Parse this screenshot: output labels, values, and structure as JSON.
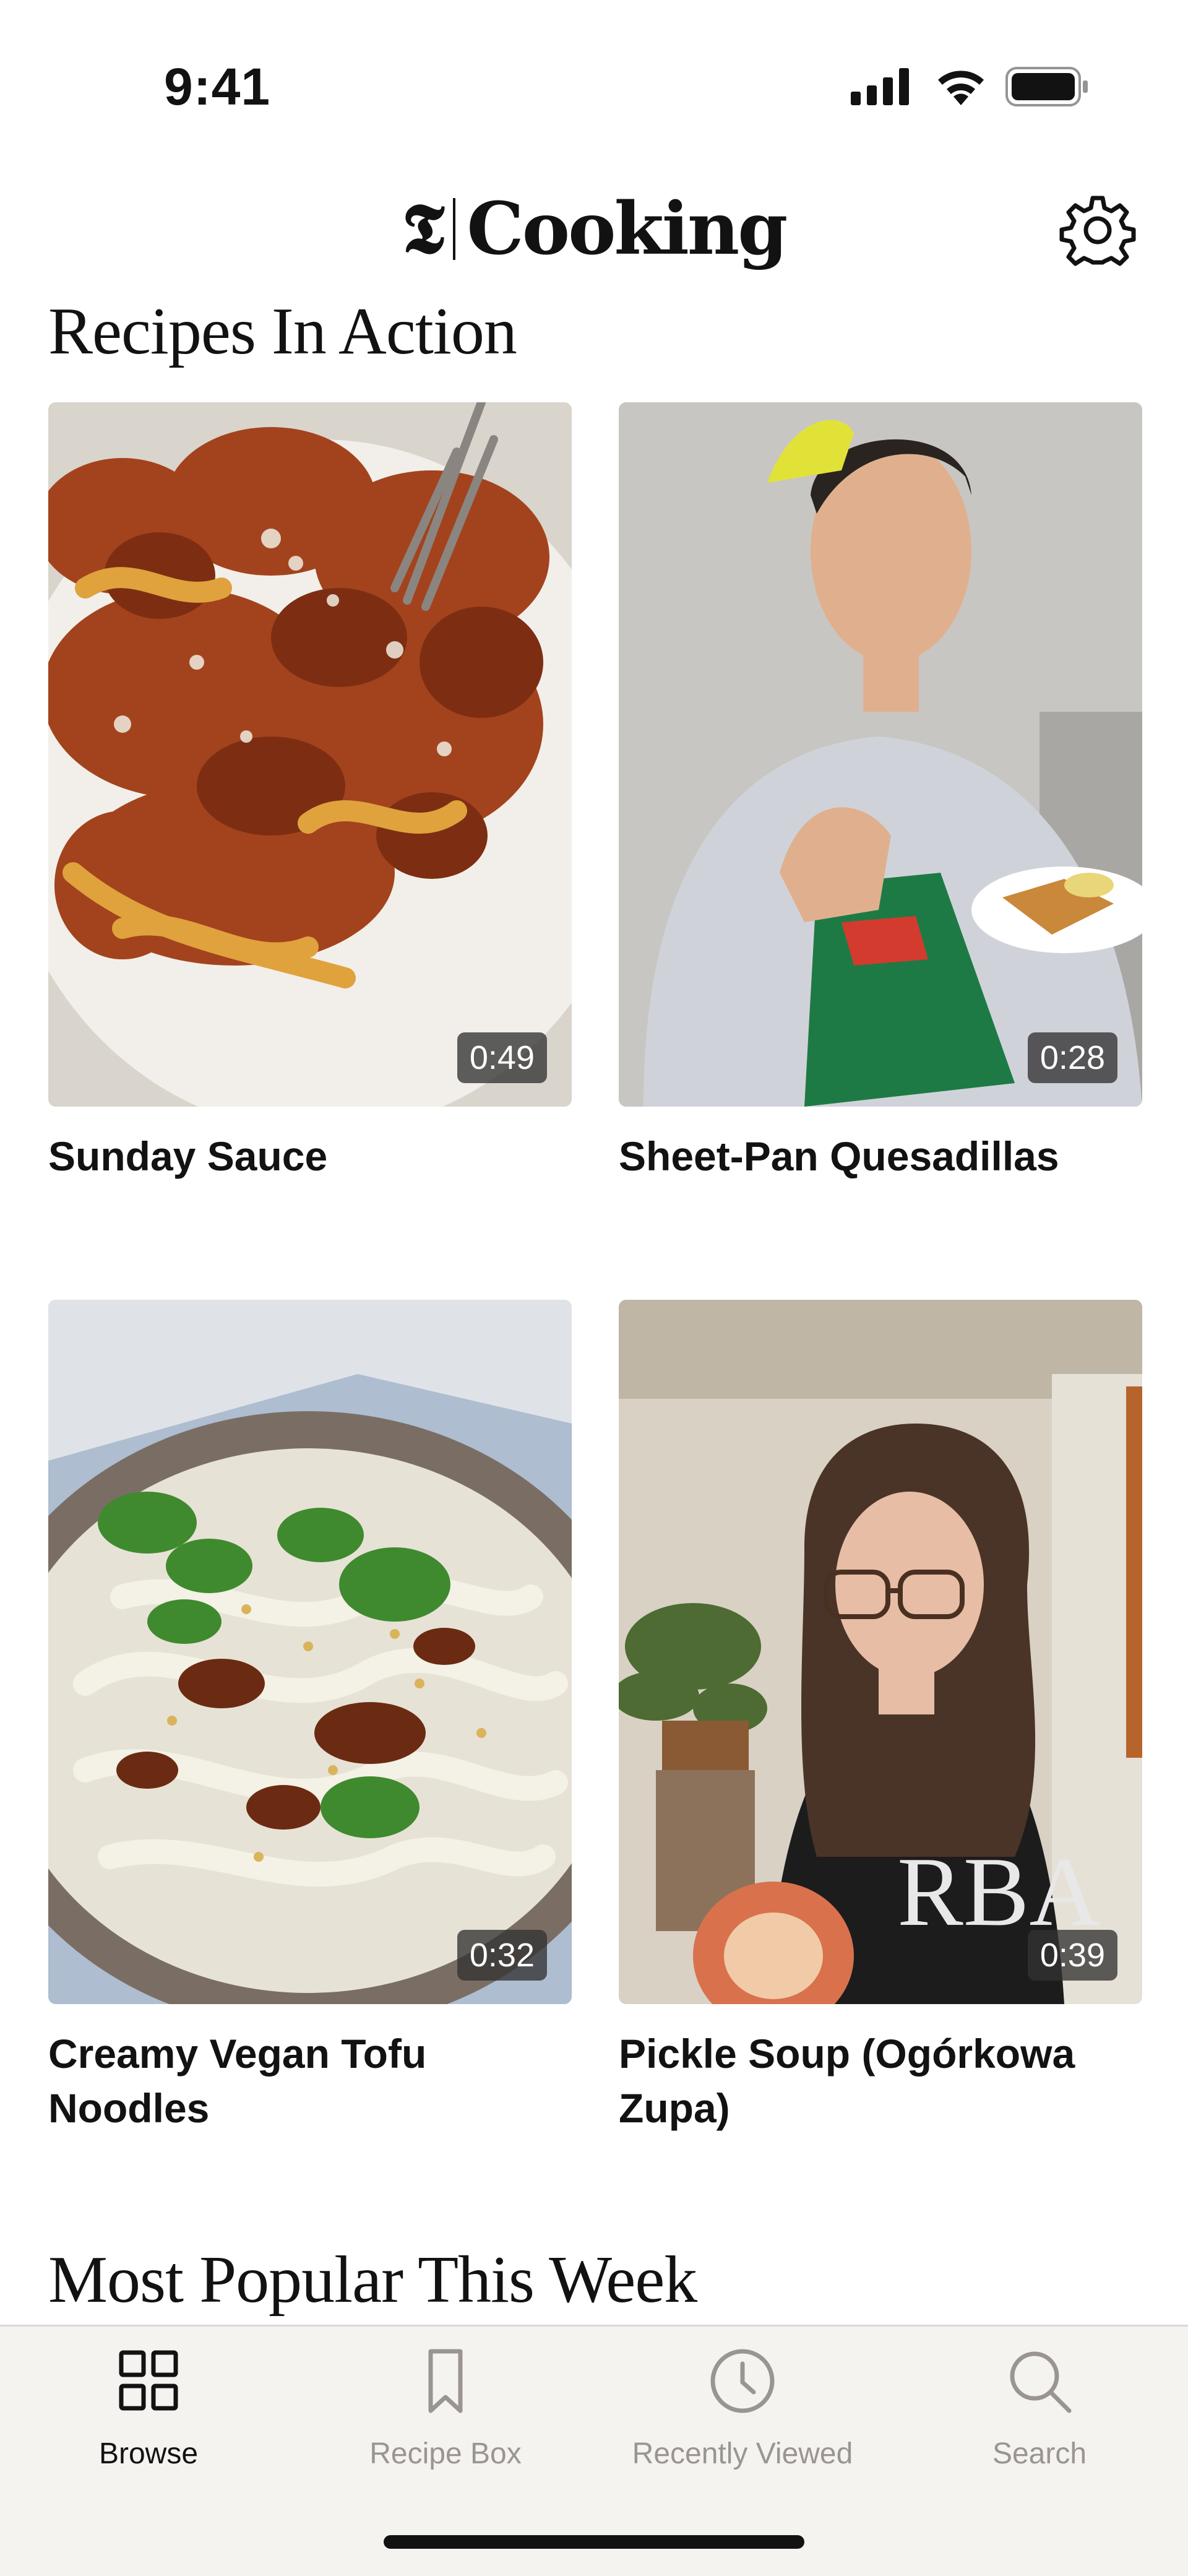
{
  "status_bar": {
    "time": "9:41",
    "icons": [
      "signal-icon",
      "wifi-icon",
      "battery-icon"
    ]
  },
  "header": {
    "logo_mark": "𝕿",
    "title": "Cooking",
    "settings_icon": "gear-icon"
  },
  "sections": {
    "recipes_in_action": "Recipes In Action",
    "most_popular": "Most Popular This Week"
  },
  "videos": [
    {
      "title": "Sunday Sauce",
      "duration": "0:49"
    },
    {
      "title": "Sheet-Pan Quesadillas",
      "duration": "0:28"
    },
    {
      "title": "Creamy Vegan Tofu Noodles",
      "duration": "0:32"
    },
    {
      "title": "Pickle Soup (Ogórkowa Zupa)",
      "duration": "0:39"
    }
  ],
  "tab_bar": {
    "tabs": [
      {
        "label": "Browse",
        "icon": "grid-icon",
        "active": true
      },
      {
        "label": "Recipe Box",
        "icon": "bookmark-icon",
        "active": false
      },
      {
        "label": "Recently Viewed",
        "icon": "clock-icon",
        "active": false
      },
      {
        "label": "Search",
        "icon": "search-icon",
        "active": false
      }
    ]
  },
  "colors": {
    "text": "#121212",
    "inactive_tab": "#9a9590",
    "tab_bar_bg": "#f5f3f0"
  }
}
